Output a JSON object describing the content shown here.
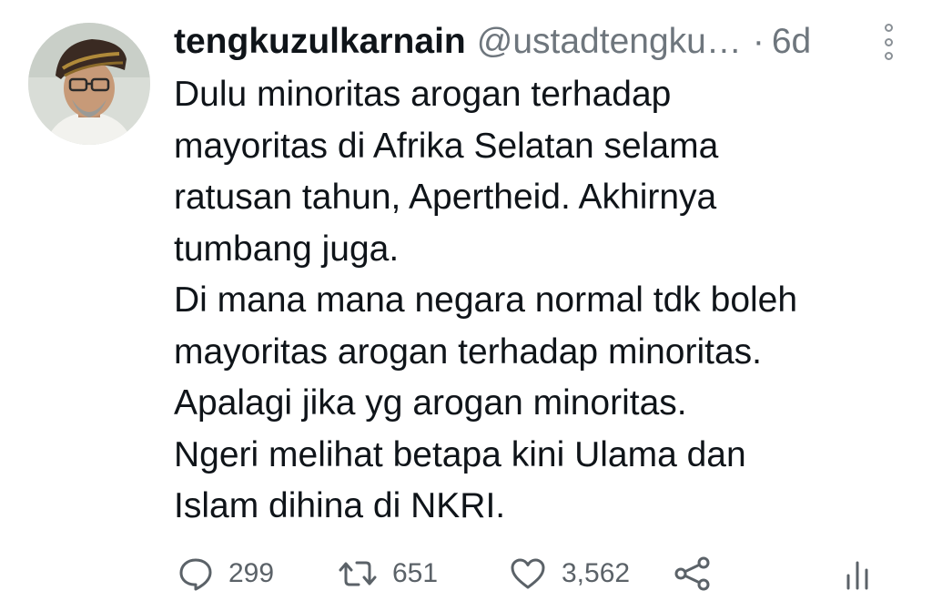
{
  "user": {
    "display_name": "tengkuzulkarnain",
    "handle": "@ustadtengku…",
    "separator": "·",
    "time": "6d"
  },
  "tweet": {
    "lines": [
      "Dulu minoritas arogan terhadap",
      "mayoritas di Afrika Selatan selama",
      "ratusan tahun, Apertheid. Akhirnya",
      "tumbang juga.",
      "Di mana mana negara normal tdk boleh",
      "mayoritas arogan terhadap minoritas.",
      "Apalagi jika yg arogan minoritas.",
      "Ngeri melihat betapa kini Ulama dan",
      "Islam dihina di NKRI."
    ]
  },
  "actions": {
    "reply_count": "299",
    "retweet_count": "651",
    "like_count": "3,562"
  },
  "icons": {
    "reply": "comment-icon",
    "retweet": "retweet-icon",
    "like": "heart-icon",
    "share": "share-icon",
    "analytics": "analytics-icon",
    "more": "more-vertical-icon"
  },
  "colors": {
    "text": "#0f1419",
    "muted": "#6e767d",
    "icon": "#5b6268"
  }
}
